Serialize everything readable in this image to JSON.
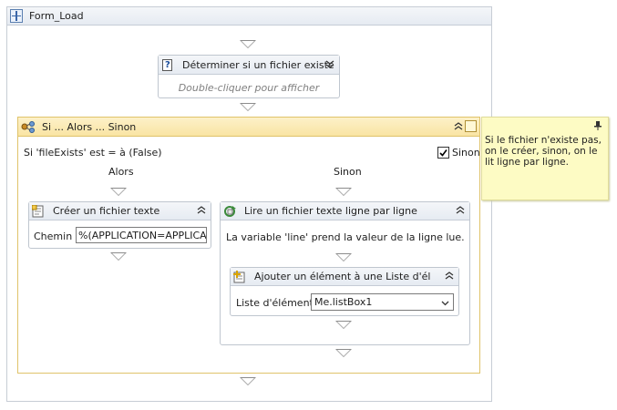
{
  "root": {
    "title": "Form_Load"
  },
  "activity_exists": {
    "title": "Déterminer si un fichier existe",
    "hint": "Double-cliquer pour afficher"
  },
  "if_block": {
    "title": "Si ... Alors ... Sinon",
    "condition": "Si 'fileExists' est = à (False)",
    "else_checkbox_label": "Sinon",
    "then_label": "Alors",
    "else_label": "Sinon"
  },
  "create_file": {
    "title": "Créer un fichier texte",
    "path_label": "Chemin :",
    "path_value": "%(APPLICATION=APPLICA"
  },
  "read_lines": {
    "title": "Lire un fichier texte ligne par ligne",
    "description": "La variable 'line' prend la valeur de la ligne lue."
  },
  "add_item": {
    "title": "Ajouter un élément à une Liste d'éléments",
    "list_label": "Liste d'éléments :",
    "list_value": "Me.listBox1"
  },
  "note": {
    "text": "Si le fichier n'existe pas, on le créer, sinon, on le lit ligne par ligne."
  }
}
